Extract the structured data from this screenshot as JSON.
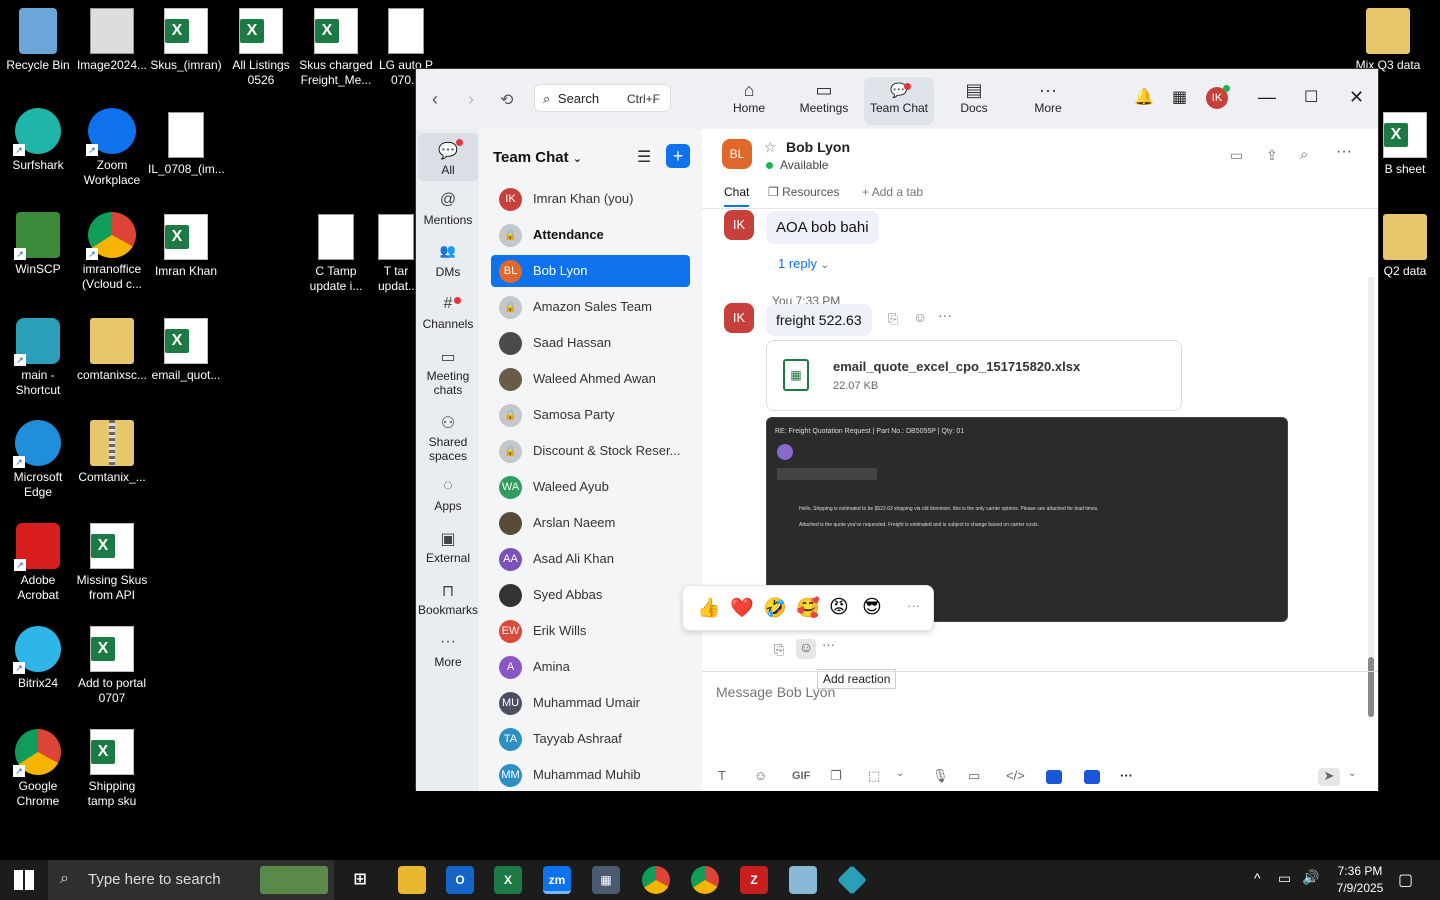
{
  "desktop": {
    "icons": [
      {
        "label": "Recycle Bin"
      },
      {
        "label": "Image2024..."
      },
      {
        "label": "Skus_(imran)"
      },
      {
        "label": "All Listings 0526"
      },
      {
        "label": "Skus charged Freight_Me..."
      },
      {
        "label": "LG auto P 070..."
      },
      {
        "label": "Mix Q3 data"
      },
      {
        "label": "Surfshark"
      },
      {
        "label": "Zoom Workplace"
      },
      {
        "label": "IL_0708_(im..."
      },
      {
        "label": "B sheet"
      },
      {
        "label": "WinSCP"
      },
      {
        "label": "imranoffice (Vcloud c..."
      },
      {
        "label": "Imran Khan"
      },
      {
        "label": "C Tamp update i..."
      },
      {
        "label": "T tar updat..."
      },
      {
        "label": "Q2 data"
      },
      {
        "label": "main - Shortcut"
      },
      {
        "label": "comtanixsc..."
      },
      {
        "label": "email_quot..."
      },
      {
        "label": "Microsoft Edge"
      },
      {
        "label": "Comtanix_..."
      },
      {
        "label": "Adobe Acrobat"
      },
      {
        "label": "Missing Skus from API"
      },
      {
        "label": "Bitrix24"
      },
      {
        "label": "Add to portal 0707"
      },
      {
        "label": "Google Chrome"
      },
      {
        "label": "Shipping tamp sku"
      }
    ]
  },
  "zoom": {
    "search": {
      "label": "Search",
      "shortcut": "Ctrl+F"
    },
    "tabs": [
      {
        "label": "Home",
        "icon": "⌂"
      },
      {
        "label": "Meetings",
        "icon": "▭"
      },
      {
        "label": "Team Chat",
        "icon": "💬"
      },
      {
        "label": "Docs",
        "icon": "▤"
      },
      {
        "label": "More",
        "icon": "···"
      }
    ],
    "user_initials": "IK",
    "leftnav": [
      {
        "label": "All",
        "icon": "💬"
      },
      {
        "label": "Mentions",
        "icon": "@"
      },
      {
        "label": "DMs",
        "icon": "👥"
      },
      {
        "label": "Channels",
        "icon": "#"
      },
      {
        "label": "Meeting chats",
        "icon": "▭"
      },
      {
        "label": "Shared spaces",
        "icon": "⚇"
      },
      {
        "label": "Apps",
        "icon": "◌"
      },
      {
        "label": "External",
        "icon": "▣"
      },
      {
        "label": "Bookmarks",
        "icon": "⊓"
      },
      {
        "label": "More",
        "icon": "···"
      }
    ],
    "chat_list_title": "Team Chat",
    "chats": [
      {
        "name": "Imran Khan (you)",
        "av": "IK",
        "color": "#c7403c"
      },
      {
        "name": "Attendance",
        "av": "🔒",
        "color": "#c4c7cc"
      },
      {
        "name": "Bob Lyon",
        "av": "BL",
        "color": "#e0682c"
      },
      {
        "name": "Amazon Sales Team",
        "av": "🔒",
        "color": "#c4c7cc"
      },
      {
        "name": "Saad Hassan",
        "av": "",
        "color": "#4a4a4a"
      },
      {
        "name": "Waleed Ahmed Awan",
        "av": "",
        "color": "#6a5a4a"
      },
      {
        "name": "Samosa Party",
        "av": "🔒",
        "color": "#c4c7cc"
      },
      {
        "name": "Discount & Stock Reser...",
        "av": "🔒",
        "color": "#c4c7cc"
      },
      {
        "name": "Waleed Ayub",
        "av": "WA",
        "color": "#2e9e5e"
      },
      {
        "name": "Arslan Naeem",
        "av": "",
        "color": "#5a4a3a"
      },
      {
        "name": "Asad Ali Khan",
        "av": "AA",
        "color": "#7a52b8"
      },
      {
        "name": "Syed Abbas",
        "av": "",
        "color": "#333"
      },
      {
        "name": "Erik Wills",
        "av": "EW",
        "color": "#d94a3a"
      },
      {
        "name": "Amina",
        "av": "A",
        "color": "#8a56c4"
      },
      {
        "name": "Muhammad Umair",
        "av": "MU",
        "color": "#4a5060"
      },
      {
        "name": "Tayyab Ashraaf",
        "av": "TA",
        "color": "#2e8fc4"
      },
      {
        "name": "Muhammad Muhib",
        "av": "MM",
        "color": "#2e8fc4"
      }
    ],
    "contact": {
      "name": "Bob Lyon",
      "initials": "BL",
      "status": "Available"
    },
    "chat_tabs": {
      "chat": "Chat",
      "resources": "Resources",
      "add": "Add a tab"
    },
    "messages": {
      "m1": "AOA bob bahi",
      "reply": "1 reply",
      "meta": "You 7:33 PM",
      "m2": "freight 522.63",
      "file_name": "email_quote_excel_cpo_151715820.xlsx",
      "file_size": "22.07 KB",
      "img_subject": "RE: Freight Quotation Request | Part No.: DB5055P | Qty: 01",
      "img_line1": "Hello, Shipping is estimated to be $522.63 shipping via old dominion. this is the only carrier options. Please see attached for lead times.",
      "img_line2": "Attached is the quote you've requested. Freight is estimated and is subject to change based on carrier costs."
    },
    "reactions": [
      "👍",
      "❤️",
      "🤣",
      "🥰",
      "😡",
      "😎"
    ],
    "tooltip": "Add reaction",
    "composer_placeholder": "Message Bob Lyon",
    "toolbar": {
      "gif": "GIF"
    }
  },
  "taskbar": {
    "search_placeholder": "Type here to search",
    "time": "7:36 PM",
    "date": "7/9/2025"
  }
}
